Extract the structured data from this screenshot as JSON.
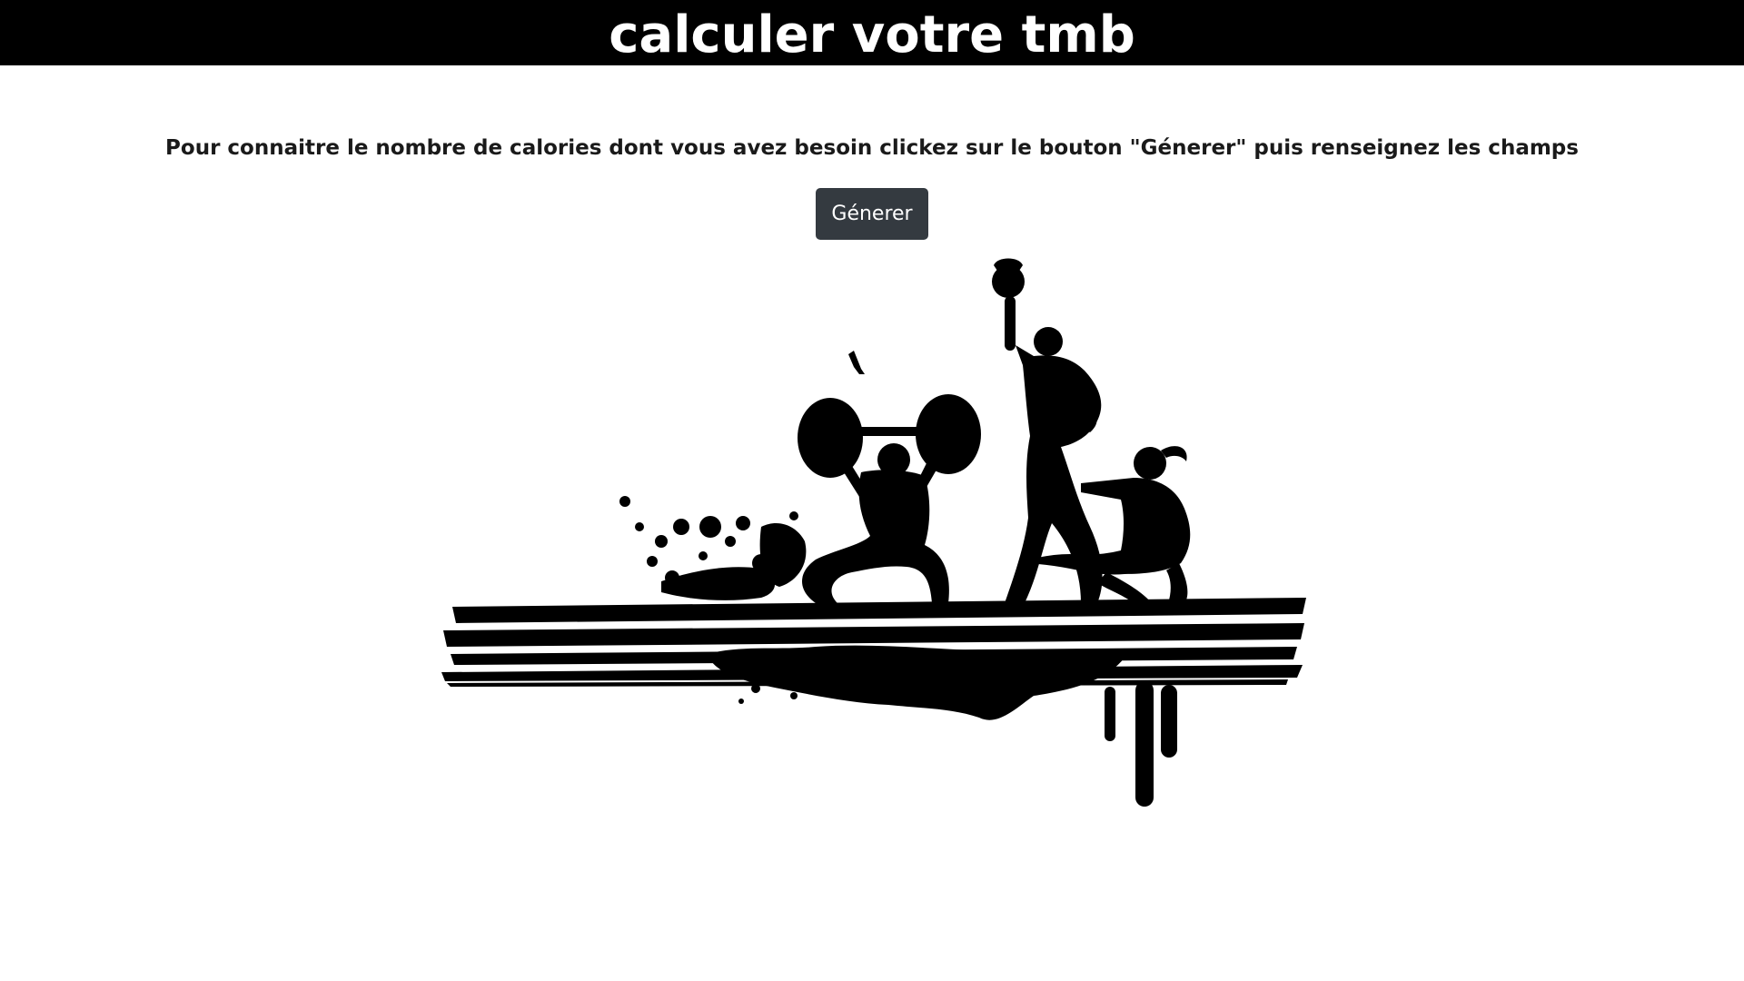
{
  "header": {
    "title": "calculer votre tmb"
  },
  "main": {
    "intro_text": "Pour connaitre le nombre de calories dont vous avez besoin clickez sur le bouton \"Génerer\" puis renseignez les champs",
    "generate_button_label": "Génerer"
  },
  "illustration": {
    "icon": "fitness-silhouettes-grunge-illustration"
  },
  "colors": {
    "header_bg": "#000000",
    "header_text": "#ffffff",
    "button_bg": "#343a40",
    "button_text": "#ffffff",
    "page_bg": "#ffffff"
  }
}
